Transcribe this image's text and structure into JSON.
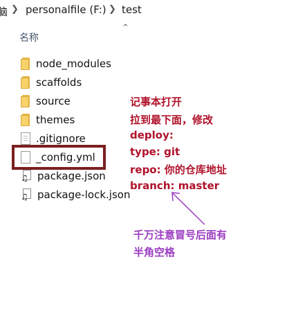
{
  "breadcrumb": {
    "partial": "脑",
    "drive": "personalfile (F:)",
    "folder": "test"
  },
  "column_header": "名称",
  "files": [
    {
      "name": "node_modules",
      "type": "folder"
    },
    {
      "name": "scaffolds",
      "type": "folder"
    },
    {
      "name": "source",
      "type": "folder"
    },
    {
      "name": "themes",
      "type": "folder"
    },
    {
      "name": ".gitignore",
      "type": "text-file"
    },
    {
      "name": "_config.yml",
      "type": "file"
    },
    {
      "name": "package.json",
      "type": "package-file"
    },
    {
      "name": "package-lock.json",
      "type": "package-file"
    }
  ],
  "annotation": {
    "lines": [
      "记事本打开",
      "拉到最下面，修改",
      "deploy:",
      "type: git",
      "repo: 你的仓库地址",
      "branch: master"
    ],
    "note": [
      "千万注意冒号后面有",
      "半角空格"
    ],
    "color_main": "#b0122b",
    "color_note": "#9a3cc0",
    "box_color": "#7b1f1f"
  }
}
